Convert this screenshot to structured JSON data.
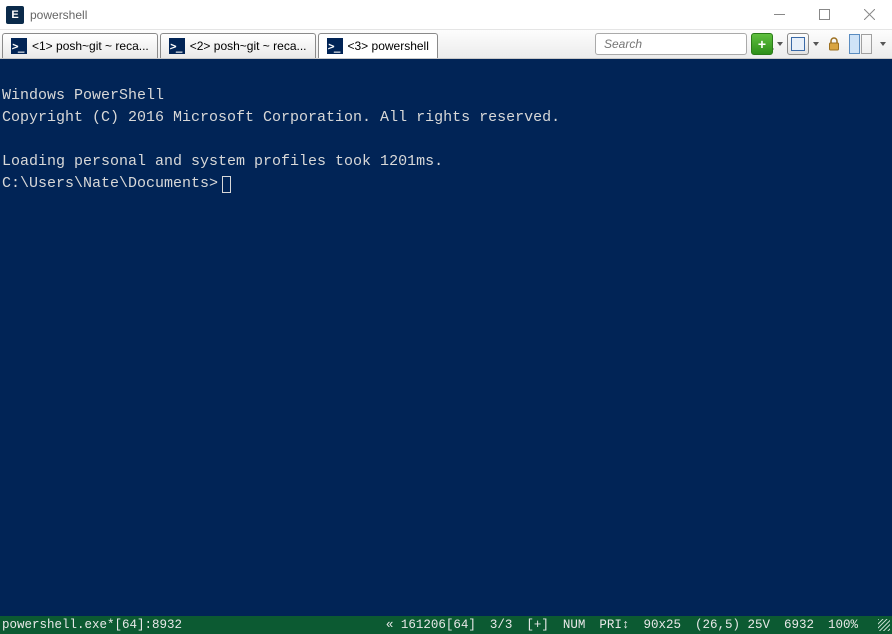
{
  "window": {
    "title": "powershell",
    "icon_letter": "E"
  },
  "tabs": [
    {
      "label": "<1> posh~git ~ reca...",
      "active": false
    },
    {
      "label": "<2> posh~git ~ reca...",
      "active": false
    },
    {
      "label": "<3> powershell",
      "active": true
    }
  ],
  "search": {
    "placeholder": "Search"
  },
  "toolbar_icons": {
    "new_tab": "+",
    "box_dropdown": "box",
    "lock": "lock",
    "panes": "panes"
  },
  "terminal": {
    "line1": "Windows PowerShell",
    "line2": "Copyright (C) 2016 Microsoft Corporation. All rights reserved.",
    "blank": "",
    "line3": "Loading personal and system profiles took 1201ms.",
    "prompt": "C:\\Users\\Nate\\Documents>"
  },
  "status": {
    "left": "powershell.exe*[64]:8932",
    "s1": "« 161206[64]",
    "s2": "3/3",
    "s3": "[+]",
    "s4": "NUM",
    "s5": "PRI↕",
    "s6": "90x25",
    "s7": "(26,5) 25V",
    "s8": "6932",
    "s9": "100%"
  }
}
